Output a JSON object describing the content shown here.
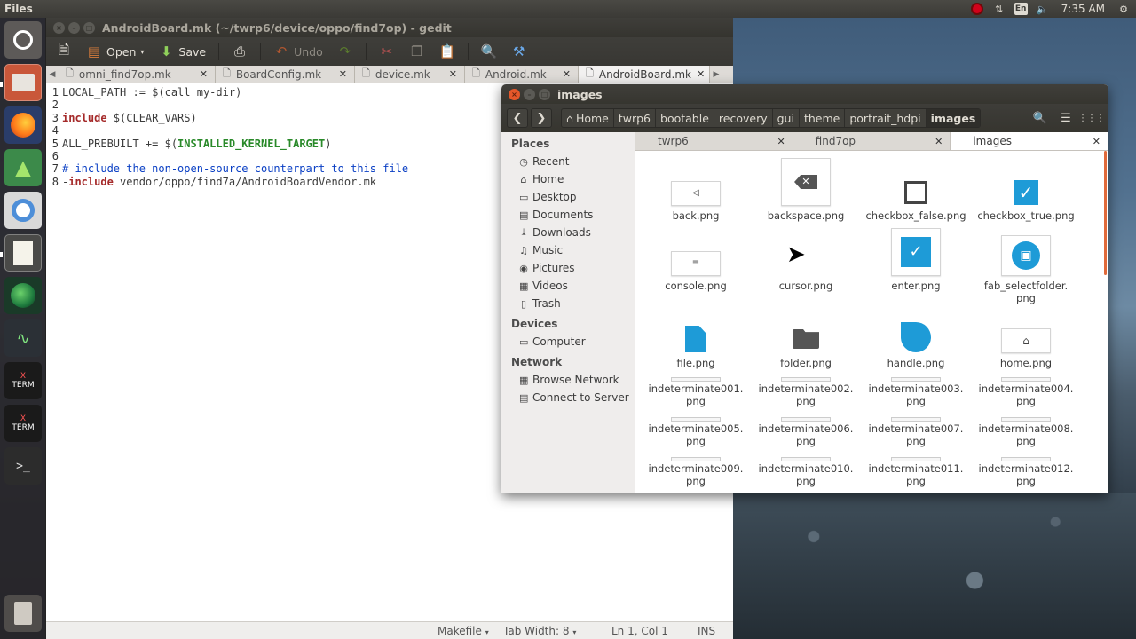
{
  "top_panel": {
    "app_name": "Files",
    "time": "7:35 AM",
    "keyboard": "En"
  },
  "launcher": {
    "items": [
      "dash",
      "files",
      "firefox",
      "android-studio",
      "chromium",
      "gedit",
      "earth",
      "system-monitor",
      "xterm",
      "xterm",
      "terminal",
      "trash"
    ]
  },
  "gedit": {
    "title": "AndroidBoard.mk (~/twrp6/device/oppo/find7op) - gedit",
    "toolbar": {
      "open": "Open",
      "save": "Save",
      "undo": "Undo"
    },
    "tabs": [
      "omni_find7op.mk",
      "BoardConfig.mk",
      "device.mk",
      "Android.mk",
      "AndroidBoard.mk"
    ],
    "lines": [
      {
        "n": "1",
        "a": "LOCAL_PATH := $(call my-dir)",
        "b": "",
        "c": "",
        "d": ""
      },
      {
        "n": "2",
        "a": "",
        "b": "",
        "c": "",
        "d": ""
      },
      {
        "n": "3",
        "a": "",
        "b": "include",
        "c": " $(CLEAR_VARS)",
        "d": ""
      },
      {
        "n": "4",
        "a": "",
        "b": "",
        "c": "",
        "d": ""
      },
      {
        "n": "5",
        "a": "ALL_PREBUILT += $(",
        "b": "",
        "c": "INSTALLED_KERNEL_TARGET",
        "d": ")"
      },
      {
        "n": "6",
        "a": "",
        "b": "",
        "c": "",
        "d": ""
      },
      {
        "n": "7",
        "a": "",
        "b": "",
        "c": "# include the non-open-source counterpart to this file",
        "d": ""
      },
      {
        "n": "8",
        "a": "-",
        "b": "include",
        "c": " vendor/oppo/find7a/AndroidBoardVendor.mk",
        "d": ""
      }
    ],
    "status": {
      "language": "Makefile",
      "tab_width": "Tab Width: 8",
      "position": "Ln 1, Col 1",
      "mode": "INS"
    }
  },
  "files": {
    "title": "images",
    "breadcrumbs": [
      "Home",
      "twrp6",
      "bootable",
      "recovery",
      "gui",
      "theme",
      "portrait_hdpi",
      "images"
    ],
    "sidebar": {
      "places_header": "Places",
      "places": [
        {
          "icon": "recent-icon",
          "label": "Recent"
        },
        {
          "icon": "home-icon",
          "label": "Home"
        },
        {
          "icon": "folder-icon",
          "label": "Desktop"
        },
        {
          "icon": "document-icon",
          "label": "Documents"
        },
        {
          "icon": "download-icon",
          "label": "Downloads"
        },
        {
          "icon": "music-icon",
          "label": "Music"
        },
        {
          "icon": "camera-icon",
          "label": "Pictures"
        },
        {
          "icon": "video-icon",
          "label": "Videos"
        },
        {
          "icon": "trash-icon",
          "label": "Trash"
        }
      ],
      "devices_header": "Devices",
      "devices": [
        {
          "icon": "computer-icon",
          "label": "Computer"
        }
      ],
      "network_header": "Network",
      "network": [
        {
          "icon": "network-icon",
          "label": "Browse Network"
        },
        {
          "icon": "server-icon",
          "label": "Connect to Server"
        }
      ]
    },
    "tabs": [
      "twrp6",
      "find7op",
      "images"
    ],
    "files": [
      {
        "l1": "back.png",
        "l2": ""
      },
      {
        "l1": "backspace.png",
        "l2": ""
      },
      {
        "l1": "checkbox_false.png",
        "l2": ""
      },
      {
        "l1": "checkbox_true.png",
        "l2": ""
      },
      {
        "l1": "console.png",
        "l2": ""
      },
      {
        "l1": "cursor.png",
        "l2": ""
      },
      {
        "l1": "enter.png",
        "l2": ""
      },
      {
        "l1": "fab_selectfolder.",
        "l2": "png"
      },
      {
        "l1": "file.png",
        "l2": ""
      },
      {
        "l1": "folder.png",
        "l2": ""
      },
      {
        "l1": "handle.png",
        "l2": ""
      },
      {
        "l1": "home.png",
        "l2": ""
      },
      {
        "l1": "indeterminate001.",
        "l2": "png"
      },
      {
        "l1": "indeterminate002.",
        "l2": "png"
      },
      {
        "l1": "indeterminate003.",
        "l2": "png"
      },
      {
        "l1": "indeterminate004.",
        "l2": "png"
      },
      {
        "l1": "indeterminate005.",
        "l2": "png"
      },
      {
        "l1": "indeterminate006.",
        "l2": "png"
      },
      {
        "l1": "indeterminate007.",
        "l2": "png"
      },
      {
        "l1": "indeterminate008.",
        "l2": "png"
      },
      {
        "l1": "indeterminate009.",
        "l2": "png"
      },
      {
        "l1": "indeterminate010.",
        "l2": "png"
      },
      {
        "l1": "indeterminate011.",
        "l2": "png"
      },
      {
        "l1": "indeterminate012.",
        "l2": "png"
      }
    ]
  },
  "colors": {
    "accent": "#1e9bd7",
    "close": "#e4572a"
  }
}
